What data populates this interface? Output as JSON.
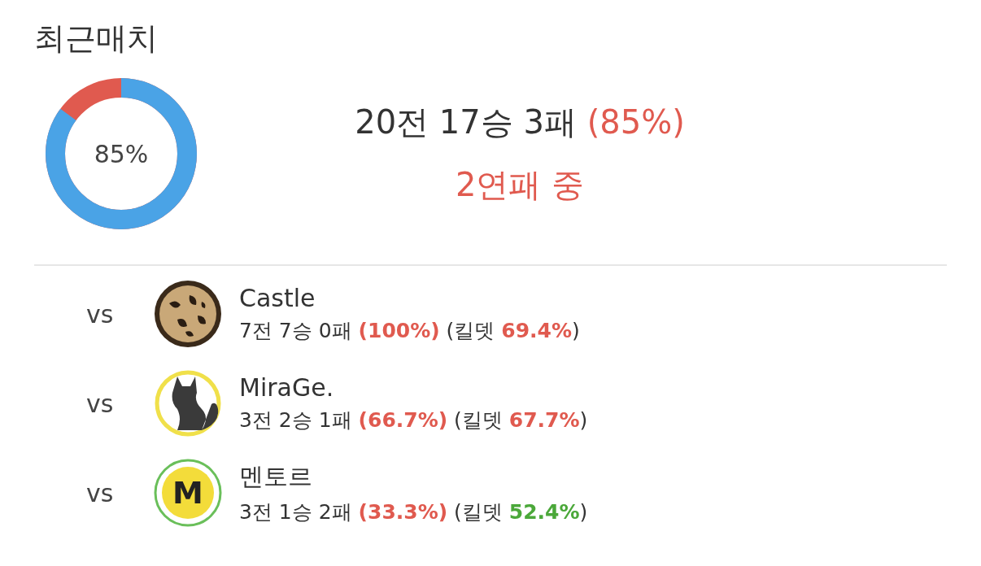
{
  "title": "최근매치",
  "summary": {
    "level": 0.85,
    "ratio_label": "85%",
    "record": "20전 17승 3패",
    "rate": "(85%)",
    "streak": "2연패 중"
  },
  "opponents": [
    {
      "vs": "vs",
      "kind": "leopard",
      "name": "Castle",
      "stats": "7전 7승 0패 **(100%)** (킬뎃 **69.4%**)",
      "color": "#e05a4f"
    },
    {
      "vs": "vs",
      "kind": "cat",
      "name": "MiraGe.",
      "stats": "3전 2승 1패 **(66.7%)** (킬뎃 **67.7%**)",
      "color": "#e05a4f"
    },
    {
      "vs": "vs",
      "kind": "letter",
      "emblem_letter": "M",
      "name": "멘토르",
      "stats": "3전 1승 2패 **(33.3%)** (킬뎃 **52.4%**)",
      "color": "#4ba83a"
    }
  ]
}
